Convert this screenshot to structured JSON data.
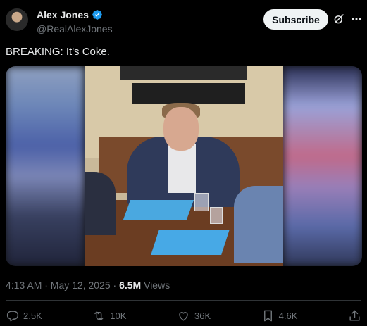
{
  "header": {
    "author_name": "Alex Jones",
    "handle": "@RealAlexJones",
    "subscribe_label": "Subscribe"
  },
  "post": {
    "text": "BREAKING: It's Coke.",
    "timestamp": "4:13 AM · May 12, 2025 · ",
    "views_count": "6.5M",
    "views_label": " Views"
  },
  "actions": {
    "replies": "2.5K",
    "reposts": "10K",
    "likes": "36K",
    "bookmarks": "4.6K"
  },
  "icons": {
    "verified": "verified-badge-icon",
    "grok": "grok-icon",
    "more": "more-icon",
    "reply": "reply-icon",
    "repost": "repost-icon",
    "like": "like-icon",
    "bookmark": "bookmark-icon",
    "share": "share-icon"
  },
  "colors": {
    "background": "#000000",
    "text": "#e7e9ea",
    "muted": "#71767b",
    "verified": "#1d9bf0",
    "button_bg": "#eff3f4"
  }
}
